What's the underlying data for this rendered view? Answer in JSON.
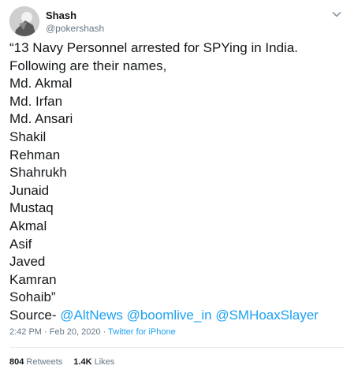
{
  "author": {
    "display_name": "Shash",
    "handle": "@pokershash"
  },
  "tweet": {
    "lines": [
      "“13 Navy Personnel arrested for SPYing in India.",
      "Following are their names,",
      "Md. Akmal",
      "Md. Irfan",
      "Md. Ansari",
      "Shakil",
      "Rehman",
      "Shahrukh",
      "Junaid",
      "Mustaq",
      "Akmal",
      "Asif",
      "Javed",
      "Kamran",
      "Sohaib”"
    ],
    "source_prefix": "Source- ",
    "mentions": [
      "@AltNews",
      "@boomlive_in",
      "@SMHoaxSlayer"
    ]
  },
  "meta": {
    "time": "2:42 PM",
    "separator": " · ",
    "date": "Feb 20, 2020",
    "source": "Twitter for iPhone"
  },
  "stats": {
    "retweets_count": "804",
    "retweets_label": "Retweets",
    "likes_count": "1.4K",
    "likes_label": "Likes"
  },
  "icons": {
    "avatar": "profile-photo",
    "menu": "chevron-down-icon"
  }
}
